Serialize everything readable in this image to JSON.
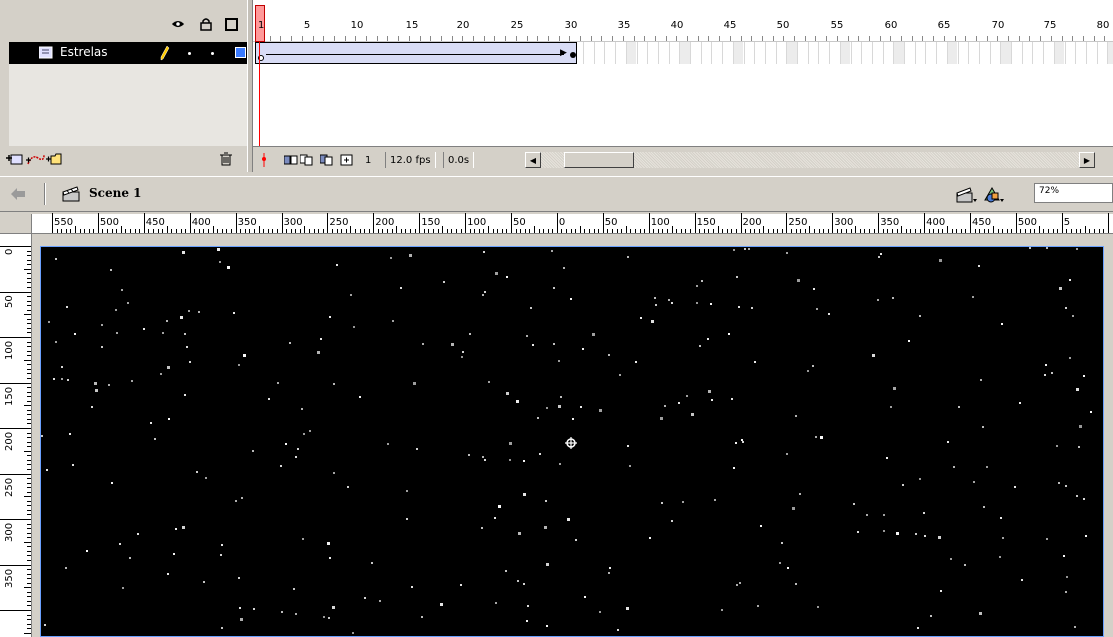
{
  "timeline": {
    "header_icons": [
      "eye-icon",
      "lock-icon",
      "outline-square-icon"
    ],
    "layer": {
      "name": "Estrelas",
      "color": "#3b7bff"
    },
    "frame_numbers": [
      "1",
      "5",
      "10",
      "15",
      "20",
      "25",
      "30",
      "35",
      "40",
      "45",
      "50",
      "55",
      "60",
      "65",
      "70",
      "75",
      "80"
    ],
    "playhead_frame": "1",
    "tween_end_frame": 30,
    "footer_icons": [
      "insert-layer-icon",
      "add-motion-guide-icon",
      "insert-folder-icon",
      "delete-layer-icon"
    ],
    "status": {
      "current_frame": "1",
      "fps": "12.0 fps",
      "time": "0.0s"
    },
    "scroll_position": 0.05
  },
  "editbar": {
    "scene_label": "Scene 1",
    "zoom": "72%"
  },
  "rulers": {
    "horizontal": [
      "550",
      "500",
      "450",
      "400",
      "350",
      "300",
      "250",
      "200",
      "150",
      "100",
      "50",
      "0",
      "50",
      "100",
      "150",
      "200",
      "250",
      "300",
      "350",
      "400",
      "450",
      "500",
      "5"
    ],
    "vertical": [
      "0",
      "50",
      "100",
      "150",
      "200",
      "250",
      "300",
      "350"
    ]
  },
  "stage": {
    "background": "#000000",
    "border_color": "#6aa0ff"
  }
}
